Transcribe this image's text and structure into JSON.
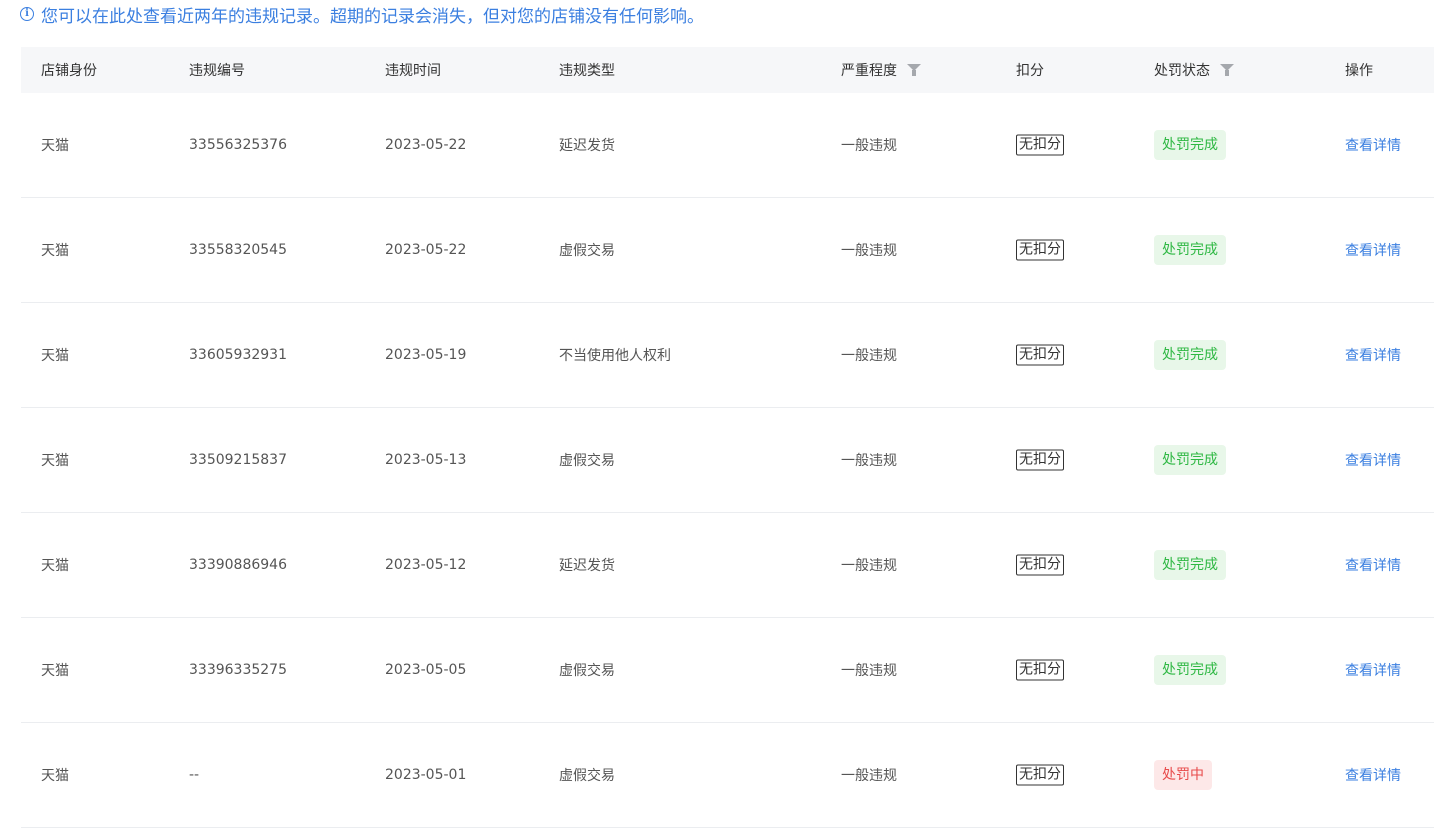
{
  "notice": {
    "icon": "info-icon",
    "text": "您可以在此处查看近两年的违规记录。超期的记录会消失，但对您的店铺没有任何影响。"
  },
  "table": {
    "headers": [
      "店铺身份",
      "违规编号",
      "违规时间",
      "违规类型",
      "严重程度",
      "扣分",
      "处罚状态",
      "操作"
    ],
    "rows": [
      {
        "shop": "天猫",
        "id": "33556325376",
        "date": "2023-05-22",
        "type": "延迟发货",
        "severity": "一般违规",
        "score": "无扣分",
        "status": "处罚完成",
        "status_kind": "done",
        "action": "查看详情"
      },
      {
        "shop": "天猫",
        "id": "33558320545",
        "date": "2023-05-22",
        "type": "虚假交易",
        "severity": "一般违规",
        "score": "无扣分",
        "status": "处罚完成",
        "status_kind": "done",
        "action": "查看详情"
      },
      {
        "shop": "天猫",
        "id": "33605932931",
        "date": "2023-05-19",
        "type": "不当使用他人权利",
        "severity": "一般违规",
        "score": "无扣分",
        "status": "处罚完成",
        "status_kind": "done",
        "action": "查看详情"
      },
      {
        "shop": "天猫",
        "id": "33509215837",
        "date": "2023-05-13",
        "type": "虚假交易",
        "severity": "一般违规",
        "score": "无扣分",
        "status": "处罚完成",
        "status_kind": "done",
        "action": "查看详情"
      },
      {
        "shop": "天猫",
        "id": "33390886946",
        "date": "2023-05-12",
        "type": "延迟发货",
        "severity": "一般违规",
        "score": "无扣分",
        "status": "处罚完成",
        "status_kind": "done",
        "action": "查看详情"
      },
      {
        "shop": "天猫",
        "id": "33396335275",
        "date": "2023-05-05",
        "type": "虚假交易",
        "severity": "一般违规",
        "score": "无扣分",
        "status": "处罚完成",
        "status_kind": "done",
        "action": "查看详情"
      },
      {
        "shop": "天猫",
        "id": "--",
        "date": "2023-05-01",
        "type": "虚假交易",
        "severity": "一般违规",
        "score": "无扣分",
        "status": "处罚中",
        "status_kind": "pending",
        "action": "查看详情"
      }
    ]
  },
  "colors": {
    "accent": "#3b7fe0",
    "status_done_bg": "#e8f7e9",
    "status_done_text": "#2fb844",
    "status_pending_bg": "#fde8e8",
    "status_pending_text": "#e84b4b",
    "header_bg": "#f6f7f9"
  }
}
